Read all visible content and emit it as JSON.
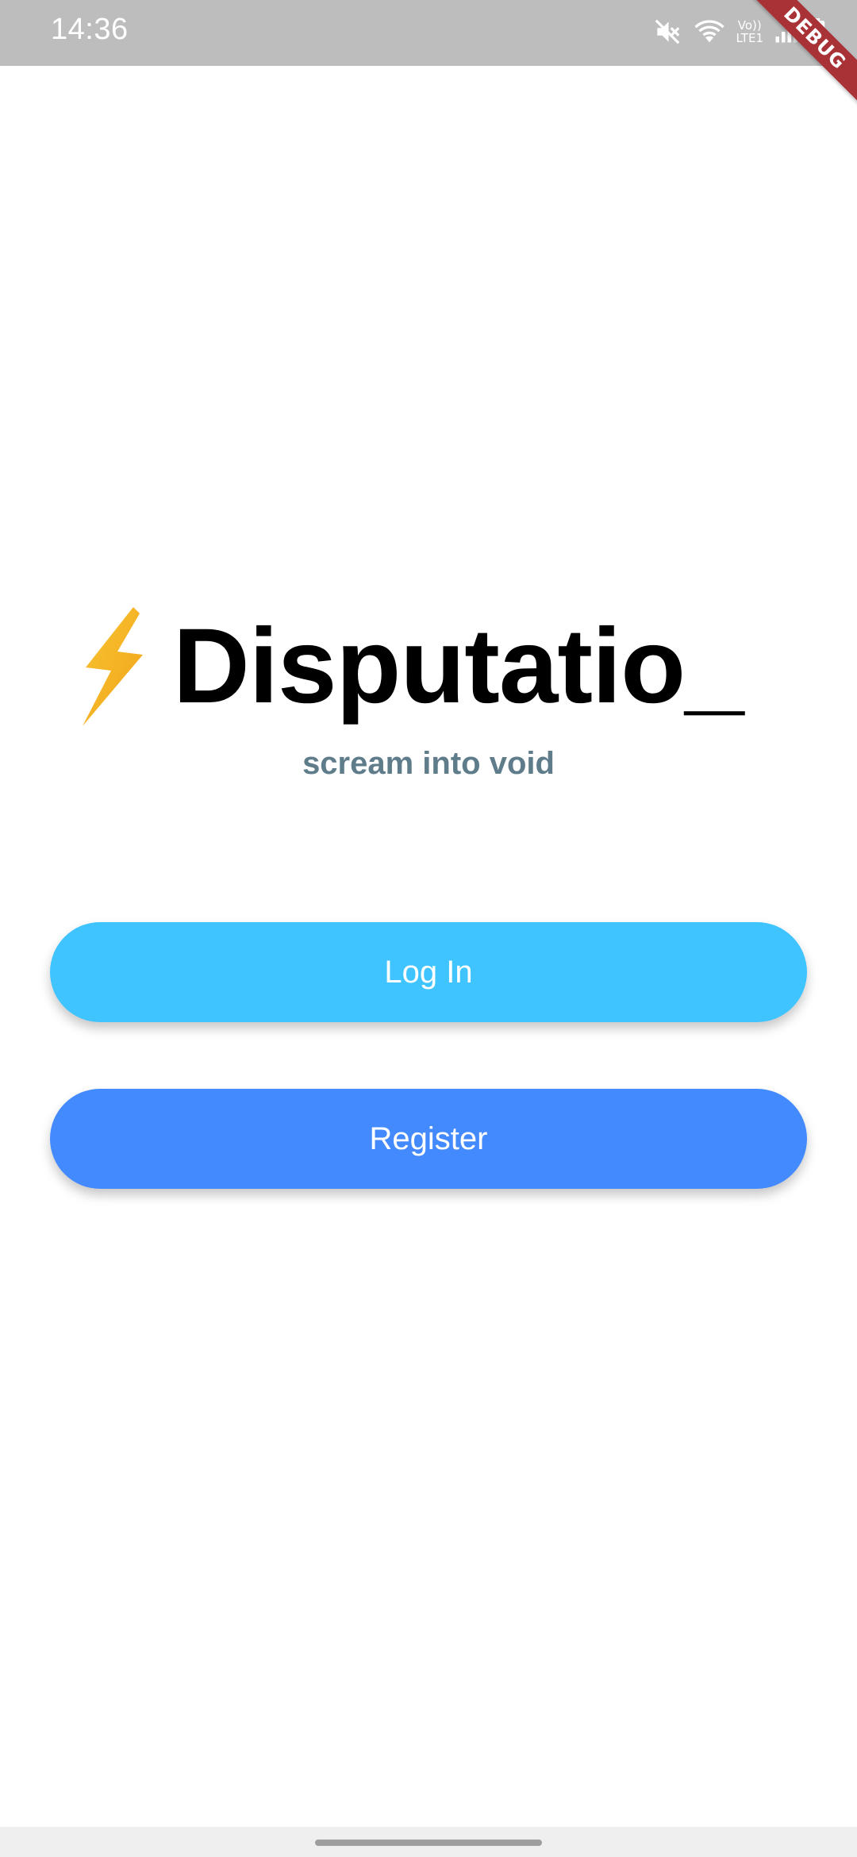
{
  "status_bar": {
    "time": "14:36",
    "network_label_top": "Vo))",
    "network_label_bottom": "LTE1",
    "icons": [
      "mute-icon",
      "wifi-icon",
      "signal-icon",
      "battery-icon"
    ]
  },
  "debug_banner": {
    "label": "DEBUG",
    "color": "#a83236"
  },
  "brand": {
    "icon": "lightning-bolt-icon",
    "title": "Disputatio_",
    "tagline": "scream into void"
  },
  "actions": {
    "login_label": "Log In",
    "register_label": "Register"
  },
  "colors": {
    "login_button": "#40c4ff",
    "register_button": "#448aff",
    "tagline": "#5f7c8a",
    "status_bar": "#bdbdbd"
  }
}
